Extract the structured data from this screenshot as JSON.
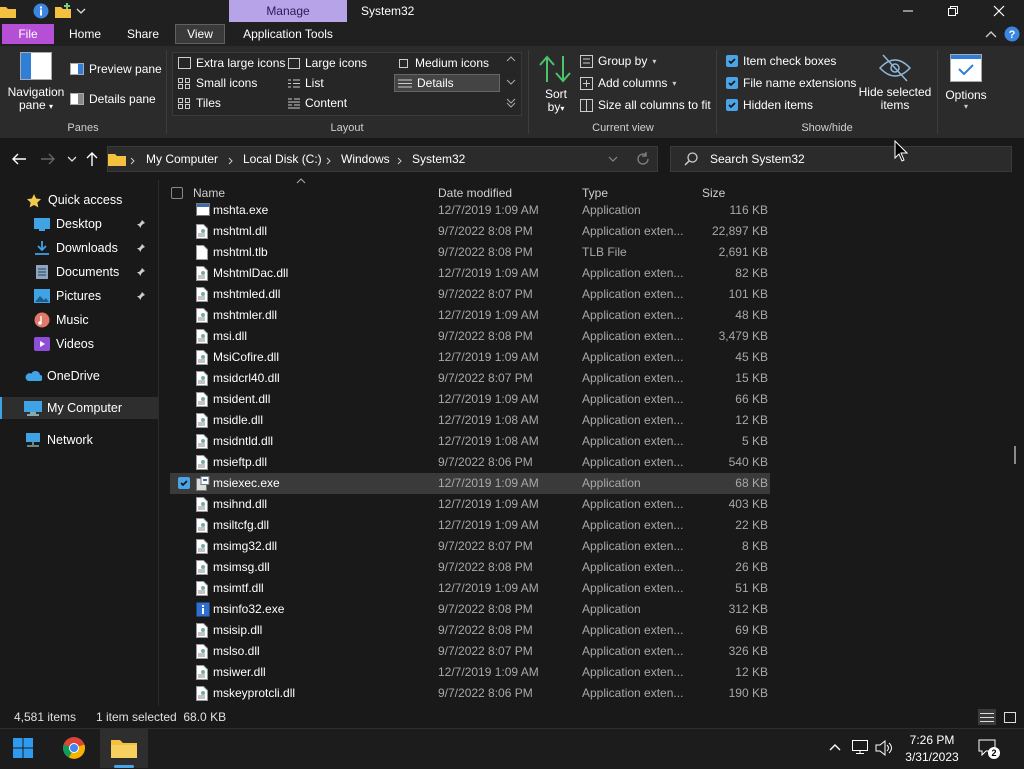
{
  "titlebar": {
    "context_tab": "Manage",
    "window_title": "System32"
  },
  "ribbon_tabs": {
    "file": "File",
    "home": "Home",
    "share": "Share",
    "view": "View",
    "app_tools": "Application Tools"
  },
  "ribbon": {
    "panes": {
      "nav_pane_line1": "Navigation",
      "nav_pane_line2": "pane",
      "preview_pane": "Preview pane",
      "details_pane": "Details pane",
      "group_label": "Panes"
    },
    "layout": {
      "extra_large": "Extra large icons",
      "large": "Large icons",
      "medium": "Medium icons",
      "small": "Small icons",
      "list": "List",
      "details": "Details",
      "tiles": "Tiles",
      "content": "Content",
      "group_label": "Layout"
    },
    "current_view": {
      "sort_line1": "Sort",
      "sort_line2": "by",
      "group_by": "Group by",
      "add_columns": "Add columns",
      "size_all": "Size all columns to fit",
      "group_label": "Current view"
    },
    "show_hide": {
      "item_check_boxes": "Item check boxes",
      "file_name_extensions": "File name extensions",
      "hidden_items": "Hidden items",
      "hide_selected_line1": "Hide selected",
      "hide_selected_line2": "items",
      "group_label": "Show/hide"
    },
    "options": "Options"
  },
  "address": {
    "breadcrumb": [
      "My Computer",
      "Local Disk (C:)",
      "Windows",
      "System32"
    ],
    "search_placeholder": "Search System32"
  },
  "nav": {
    "quick_access": "Quick access",
    "desktop": "Desktop",
    "downloads": "Downloads",
    "documents": "Documents",
    "pictures": "Pictures",
    "music": "Music",
    "videos": "Videos",
    "onedrive": "OneDrive",
    "my_computer": "My Computer",
    "network": "Network"
  },
  "columns": {
    "name": "Name",
    "date": "Date modified",
    "type": "Type",
    "size": "Size"
  },
  "files": [
    {
      "name": "mshta.exe",
      "date": "12/7/2019 1:09 AM",
      "type": "Application",
      "size": "116 KB",
      "icon": "exe"
    },
    {
      "name": "mshtml.dll",
      "date": "9/7/2022 8:08 PM",
      "type": "Application exten...",
      "size": "22,897 KB",
      "icon": "dll"
    },
    {
      "name": "mshtml.tlb",
      "date": "9/7/2022 8:08 PM",
      "type": "TLB File",
      "size": "2,691 KB",
      "icon": "blank"
    },
    {
      "name": "MshtmlDac.dll",
      "date": "12/7/2019 1:09 AM",
      "type": "Application exten...",
      "size": "82 KB",
      "icon": "dll"
    },
    {
      "name": "mshtmled.dll",
      "date": "9/7/2022 8:07 PM",
      "type": "Application exten...",
      "size": "101 KB",
      "icon": "dll"
    },
    {
      "name": "mshtmler.dll",
      "date": "12/7/2019 1:09 AM",
      "type": "Application exten...",
      "size": "48 KB",
      "icon": "dll"
    },
    {
      "name": "msi.dll",
      "date": "9/7/2022 8:08 PM",
      "type": "Application exten...",
      "size": "3,479 KB",
      "icon": "dll"
    },
    {
      "name": "MsiCofire.dll",
      "date": "12/7/2019 1:09 AM",
      "type": "Application exten...",
      "size": "45 KB",
      "icon": "dll"
    },
    {
      "name": "msidcrl40.dll",
      "date": "9/7/2022 8:07 PM",
      "type": "Application exten...",
      "size": "15 KB",
      "icon": "dll"
    },
    {
      "name": "msident.dll",
      "date": "12/7/2019 1:09 AM",
      "type": "Application exten...",
      "size": "66 KB",
      "icon": "dll"
    },
    {
      "name": "msidle.dll",
      "date": "12/7/2019 1:08 AM",
      "type": "Application exten...",
      "size": "12 KB",
      "icon": "dll"
    },
    {
      "name": "msidntld.dll",
      "date": "12/7/2019 1:08 AM",
      "type": "Application exten...",
      "size": "5 KB",
      "icon": "dll"
    },
    {
      "name": "msieftp.dll",
      "date": "9/7/2022 8:06 PM",
      "type": "Application exten...",
      "size": "540 KB",
      "icon": "dll"
    },
    {
      "name": "msiexec.exe",
      "date": "12/7/2019 1:09 AM",
      "type": "Application",
      "size": "68 KB",
      "icon": "msiexec",
      "selected": true
    },
    {
      "name": "msihnd.dll",
      "date": "12/7/2019 1:09 AM",
      "type": "Application exten...",
      "size": "403 KB",
      "icon": "dll"
    },
    {
      "name": "msiltcfg.dll",
      "date": "12/7/2019 1:09 AM",
      "type": "Application exten...",
      "size": "22 KB",
      "icon": "dll"
    },
    {
      "name": "msimg32.dll",
      "date": "9/7/2022 8:07 PM",
      "type": "Application exten...",
      "size": "8 KB",
      "icon": "dll"
    },
    {
      "name": "msimsg.dll",
      "date": "9/7/2022 8:08 PM",
      "type": "Application exten...",
      "size": "26 KB",
      "icon": "dll"
    },
    {
      "name": "msimtf.dll",
      "date": "12/7/2019 1:09 AM",
      "type": "Application exten...",
      "size": "51 KB",
      "icon": "dll"
    },
    {
      "name": "msinfo32.exe",
      "date": "9/7/2022 8:08 PM",
      "type": "Application",
      "size": "312 KB",
      "icon": "info"
    },
    {
      "name": "msisip.dll",
      "date": "9/7/2022 8:08 PM",
      "type": "Application exten...",
      "size": "69 KB",
      "icon": "dll"
    },
    {
      "name": "mslso.dll",
      "date": "9/7/2022 8:07 PM",
      "type": "Application exten...",
      "size": "326 KB",
      "icon": "dll"
    },
    {
      "name": "msiwer.dll",
      "date": "12/7/2019 1:09 AM",
      "type": "Application exten...",
      "size": "12 KB",
      "icon": "dll"
    },
    {
      "name": "mskeyprotcli.dll",
      "date": "9/7/2022 8:06 PM",
      "type": "Application exten...",
      "size": "190 KB",
      "icon": "dll"
    }
  ],
  "status": {
    "item_count": "4,581 items",
    "selection": "1 item selected  68.0 KB"
  },
  "taskbar": {
    "time": "7:26 PM",
    "date": "3/31/2023",
    "notification_count": "2"
  },
  "colors": {
    "accent": "#4aa4e8",
    "file_tab": "#b44fd6",
    "manage_tab": "#b6a3e8",
    "folder": "#f3c03f"
  }
}
